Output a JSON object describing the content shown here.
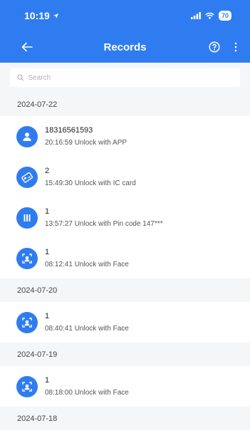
{
  "status_bar": {
    "time": "10:19",
    "battery": "70"
  },
  "nav": {
    "title": "Records"
  },
  "search": {
    "placeholder": "Search"
  },
  "groups": [
    {
      "date": "2024-07-22",
      "records": [
        {
          "user": "18316561593",
          "detail": "20:16:59 Unlock with APP",
          "icon": "user-icon"
        },
        {
          "user": "2",
          "detail": "15:49:30 Unlock with IC card",
          "icon": "ic-card-icon"
        },
        {
          "user": "1",
          "detail": "13:57:27 Unlock with Pin code 147***",
          "icon": "keypad-icon"
        },
        {
          "user": "1",
          "detail": "08:12:41 Unlock with Face",
          "icon": "face-icon"
        }
      ]
    },
    {
      "date": "2024-07-20",
      "records": [
        {
          "user": "1",
          "detail": "08:40:41 Unlock with Face",
          "icon": "face-icon"
        }
      ]
    },
    {
      "date": "2024-07-19",
      "records": [
        {
          "user": "1",
          "detail": "08:18:00 Unlock with Face",
          "icon": "face-icon"
        }
      ]
    },
    {
      "date": "2024-07-18",
      "records": []
    }
  ],
  "colors": {
    "accent": "#2f7cf0",
    "section_bg": "#f5f6f8"
  }
}
